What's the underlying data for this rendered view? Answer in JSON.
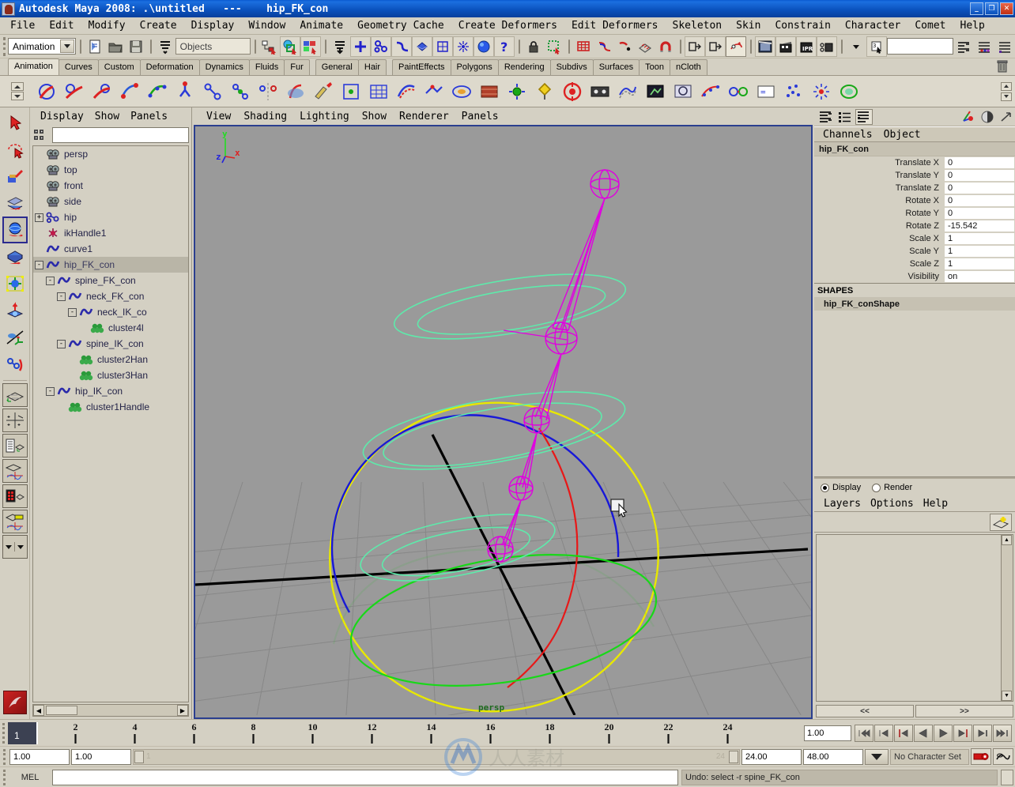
{
  "window": {
    "title": "Autodesk Maya 2008: .\\untitled   ---    hip_FK_con",
    "min_label": "_",
    "max_label": "❐",
    "close_label": "✕"
  },
  "menubar": {
    "items": [
      "File",
      "Edit",
      "Modify",
      "Create",
      "Display",
      "Window",
      "Animate",
      "Geometry Cache",
      "Create Deformers",
      "Edit Deformers",
      "Skeleton",
      "Skin",
      "Constrain",
      "Character",
      "Comet",
      "Help"
    ]
  },
  "statusline": {
    "menuset": "Animation",
    "selection_mask": "Objects",
    "numeric_field": "",
    "icons": [
      "new-scene-icon",
      "open-scene-icon",
      "save-scene-icon",
      "selection-mode-icon",
      "select-by-hierarchy-icon",
      "select-by-object-icon",
      "select-by-component-icon",
      "component-mask-icon",
      "handles-mask-icon",
      "joints-mask-icon",
      "curves-mask-icon",
      "surfaces-mask-icon",
      "deformers-mask-icon",
      "dynamics-mask-icon",
      "rendering-mask-icon",
      "misc-mask-icon",
      "lock-icon",
      "highlight-icon",
      "snap-grid-icon",
      "snap-curve-icon",
      "snap-point-icon",
      "snap-view-plane-icon",
      "snap-magnet-icon",
      "construction-history-icon",
      "input-connections-icon",
      "output-connections-icon",
      "render-current-frame-icon",
      "render-sequence-icon",
      "ipr-render-icon",
      "render-globals-icon",
      "quick-select-dropdown-icon",
      "attribute-editor-icon",
      "channel-box-icon",
      "layer-editor-icon"
    ]
  },
  "shelf": {
    "tabs": [
      "Animation",
      "Curves",
      "Custom",
      "Deformation",
      "Dynamics",
      "Fluids",
      "Fur",
      "General",
      "Hair",
      "PaintEffects",
      "Polygons",
      "Rendering",
      "Subdivs",
      "Surfaces",
      "Toon",
      "nCloth"
    ],
    "selected_tab": "Animation",
    "trash_icon": "trash-icon",
    "icons": [
      "set-key-icon",
      "set-key-translate-icon",
      "set-key-rotate-icon",
      "ik-handle-icon",
      "ik-spline-handle-icon",
      "ik-full-body-icon",
      "joint-tool-icon",
      "insert-joint-icon",
      "mirror-joint-icon",
      "skin-bind-icon",
      "paint-weights-icon",
      "cluster-icon",
      "lattice-icon",
      "wire-tool-icon",
      "blendshape-icon",
      "wrap-icon",
      "cloth-icon",
      "cluster-handle-icon",
      "create-character-icon",
      "pose-icon",
      "motion-capture-icon",
      "ghosting-icon",
      "playblast-icon",
      "snapshot-icon",
      "motion-trail-icon",
      "constraint-icon",
      "expression-icon",
      "particle-icon",
      "dynamic-icon",
      "soft-body-icon"
    ]
  },
  "toolbox": {
    "tools": [
      "select-tool-icon",
      "lasso-select-tool-icon",
      "paint-select-tool-icon",
      "move-tool-icon",
      "rotate-tool-icon",
      "scale-tool-icon",
      "universal-manipulator-icon",
      "soft-modification-tool-icon",
      "show-manipulator-tool-icon",
      "last-tool-used-icon"
    ],
    "selected_tool": "rotate-tool-icon",
    "layouts": [
      "single-perspective-layout-icon",
      "four-view-layout-icon",
      "outliner-persp-layout-icon",
      "persp-graph-layout-icon",
      "hypershade-persp-layout-icon",
      "persp-graph-alt-layout-icon",
      "layout-menu-left-icon",
      "layout-menu-right-icon"
    ],
    "help_icon": "maya-help-icon"
  },
  "outliner": {
    "menus": [
      "Display",
      "Show",
      "Panels"
    ],
    "filter_icon": "outliner-filter-icon",
    "search_value": "",
    "scroll_left_icon": "scroll-left-icon",
    "scroll_right_icon": "scroll-right-icon",
    "items": [
      {
        "label": "persp",
        "icon": "camera-icon",
        "indent": 0,
        "expander": "",
        "selected": false
      },
      {
        "label": "top",
        "icon": "camera-icon",
        "indent": 0,
        "expander": "",
        "selected": false
      },
      {
        "label": "front",
        "icon": "camera-icon",
        "indent": 0,
        "expander": "",
        "selected": false
      },
      {
        "label": "side",
        "icon": "camera-icon",
        "indent": 0,
        "expander": "",
        "selected": false
      },
      {
        "label": "hip",
        "icon": "joint-icon",
        "indent": 0,
        "expander": "+",
        "selected": false
      },
      {
        "label": "ikHandle1",
        "icon": "ikhandle-icon",
        "indent": 0,
        "expander": "",
        "selected": false
      },
      {
        "label": "curve1",
        "icon": "curve-icon",
        "indent": 0,
        "expander": "",
        "selected": false
      },
      {
        "label": "hip_FK_con",
        "icon": "curve-icon",
        "indent": 0,
        "expander": "-",
        "selected": true
      },
      {
        "label": "spine_FK_con",
        "icon": "curve-icon",
        "indent": 1,
        "expander": "-",
        "selected": false
      },
      {
        "label": "neck_FK_con",
        "icon": "curve-icon",
        "indent": 2,
        "expander": "-",
        "selected": false
      },
      {
        "label": "neck_IK_co",
        "icon": "curve-icon",
        "indent": 3,
        "expander": "-",
        "selected": false
      },
      {
        "label": "cluster4l",
        "icon": "cluster-icon",
        "indent": 4,
        "expander": "",
        "selected": false
      },
      {
        "label": "spine_IK_con",
        "icon": "curve-icon",
        "indent": 2,
        "expander": "-",
        "selected": false
      },
      {
        "label": "cluster2Han",
        "icon": "cluster-icon",
        "indent": 3,
        "expander": "",
        "selected": false
      },
      {
        "label": "cluster3Han",
        "icon": "cluster-icon",
        "indent": 3,
        "expander": "",
        "selected": false
      },
      {
        "label": "hip_IK_con",
        "icon": "curve-icon",
        "indent": 1,
        "expander": "-",
        "selected": false
      },
      {
        "label": "cluster1Handle",
        "icon": "cluster-icon",
        "indent": 2,
        "expander": "",
        "selected": false
      }
    ]
  },
  "viewport": {
    "menus": [
      "View",
      "Shading",
      "Lighting",
      "Show",
      "Renderer",
      "Panels"
    ],
    "camera_label": "persp",
    "axis_labels": {
      "x": "x",
      "y": "y",
      "z": "z"
    },
    "background_color": "#9a9a9a",
    "cursor": "arrow-cursor"
  },
  "channelbox": {
    "toolbar_icons": [
      "show-channel-box-icon",
      "show-layer-editor-icon",
      "show-both-icon",
      "attribute-editor-icon",
      "tool-settings-icon",
      "channel-box-arrow-icon"
    ],
    "menus": [
      "Channels",
      "Object"
    ],
    "object_name": "hip_FK_con",
    "attributes": [
      {
        "name": "Translate X",
        "value": "0"
      },
      {
        "name": "Translate Y",
        "value": "0"
      },
      {
        "name": "Translate Z",
        "value": "0"
      },
      {
        "name": "Rotate X",
        "value": "0"
      },
      {
        "name": "Rotate Y",
        "value": "0"
      },
      {
        "name": "Rotate Z",
        "value": "-15.542"
      },
      {
        "name": "Scale X",
        "value": "1"
      },
      {
        "name": "Scale Y",
        "value": "1"
      },
      {
        "name": "Scale Z",
        "value": "1"
      },
      {
        "name": "Visibility",
        "value": "on"
      }
    ],
    "shapes_header": "SHAPES",
    "shape_name": "hip_FK_conShape"
  },
  "layereditor": {
    "display_radio": "Display",
    "render_radio": "Render",
    "selected_radio": "Display",
    "menus": [
      "Layers",
      "Options",
      "Help"
    ],
    "new_layer_icon": "new-layer-icon",
    "prev_label": "<<",
    "next_label": ">>"
  },
  "timeslider": {
    "current_frame_label": "1",
    "current_frame_field": "1.00",
    "tick_labels": [
      "2",
      "4",
      "6",
      "8",
      "10",
      "12",
      "14",
      "16",
      "18",
      "20",
      "22",
      "24"
    ],
    "playback_buttons": [
      "go-to-start-icon",
      "step-back-frame-icon",
      "step-back-key-icon",
      "play-backwards-icon",
      "play-forwards-icon",
      "step-forward-key-icon",
      "step-forward-frame-icon",
      "go-to-end-icon"
    ]
  },
  "rangeslider": {
    "anim_start": "1.00",
    "range_start": "1.00",
    "bar_start_label": "1",
    "bar_end_label": "24",
    "range_end": "24.00",
    "anim_end": "48.00",
    "character_set": "No Character Set",
    "auto_key_icon": "auto-keyframe-icon",
    "anim_prefs_icon": "animation-preferences-icon"
  },
  "commandline": {
    "label": "MEL",
    "input_value": "",
    "status": "Undo: select -r spine_FK_con"
  },
  "colors": {
    "title_bar": "#0a50bb",
    "panel_bg": "#d4d0c3",
    "viewport_bg": "#9a9a9a",
    "viewport_border": "#2b3f8f",
    "selected_row": "#b9b5a7",
    "curve_magenta": "#e000e0",
    "curve_green": "#3ce8a0",
    "circle_yellow": "#e8e800",
    "circle_blue": "#1818d8",
    "circle_red": "#e81818",
    "circle_green": "#18d818",
    "axis_black": "#000000",
    "grid_line": "#868686"
  }
}
